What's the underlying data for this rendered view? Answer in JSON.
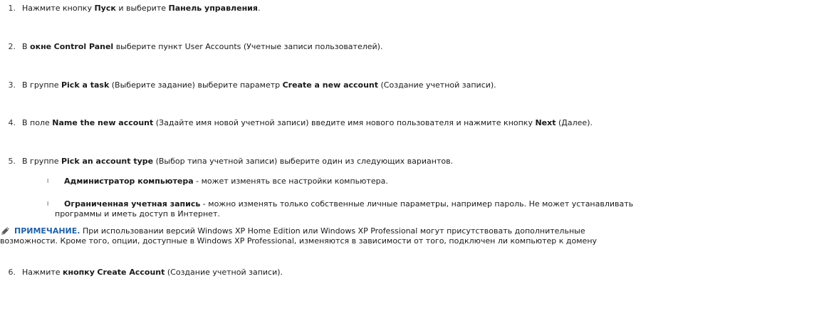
{
  "steps": [
    {
      "num": "1.",
      "parts": [
        "Нажмите кнопку ",
        "Пуск",
        " и выберите ",
        "Панель управления",
        "."
      ]
    },
    {
      "num": "2.",
      "parts": [
        "В ",
        "окне",
        " ",
        "Control Panel",
        " выберите пункт User Accounts (Учетные записи пользователей)."
      ]
    },
    {
      "num": "3.",
      "parts": [
        "В группе ",
        "Pick a task",
        " (Выберите задание) выберите параметр ",
        "Create a new account",
        " (Создание учетной записи)."
      ]
    },
    {
      "num": "4.",
      "parts": [
        "В поле ",
        "Name the new account",
        " (Задайте имя новой учетной записи) введите имя нового пользователя и нажмите кнопку ",
        "Next",
        " (Далее)."
      ]
    },
    {
      "num": "5.",
      "parts": [
        "В группе ",
        "Pick an account type",
        " (Выбор типа учетной записи) выберите один из следующих вариантов."
      ]
    },
    {
      "num": "6.",
      "parts": [
        "Нажмите ",
        "кнопку",
        " ",
        "Create Account",
        " (Создание учетной записи)."
      ]
    }
  ],
  "options": [
    {
      "bullet": "l",
      "title": "Администратор компьютера",
      "text": " - может изменять все настройки компьютера."
    },
    {
      "bullet": "l",
      "title": "Ограниченная учетная запись",
      "text": " - можно изменять только собственные личные параметры, например пароль. Не может устанавливать",
      "continuation": "программы и иметь доступ в Интернет."
    }
  ],
  "note": {
    "icon": "pencil-note-icon",
    "label": "ПРИМЕЧАНИЕ.",
    "line1": " При использовании версий Windows XP Home Edition или Windows XP Professional могут присутствовать дополнительные",
    "line2": "возможности. Кроме того, опции, доступные в Windows XP Professional, изменяются в зависимости от того, подключен ли компьютер к домену"
  }
}
